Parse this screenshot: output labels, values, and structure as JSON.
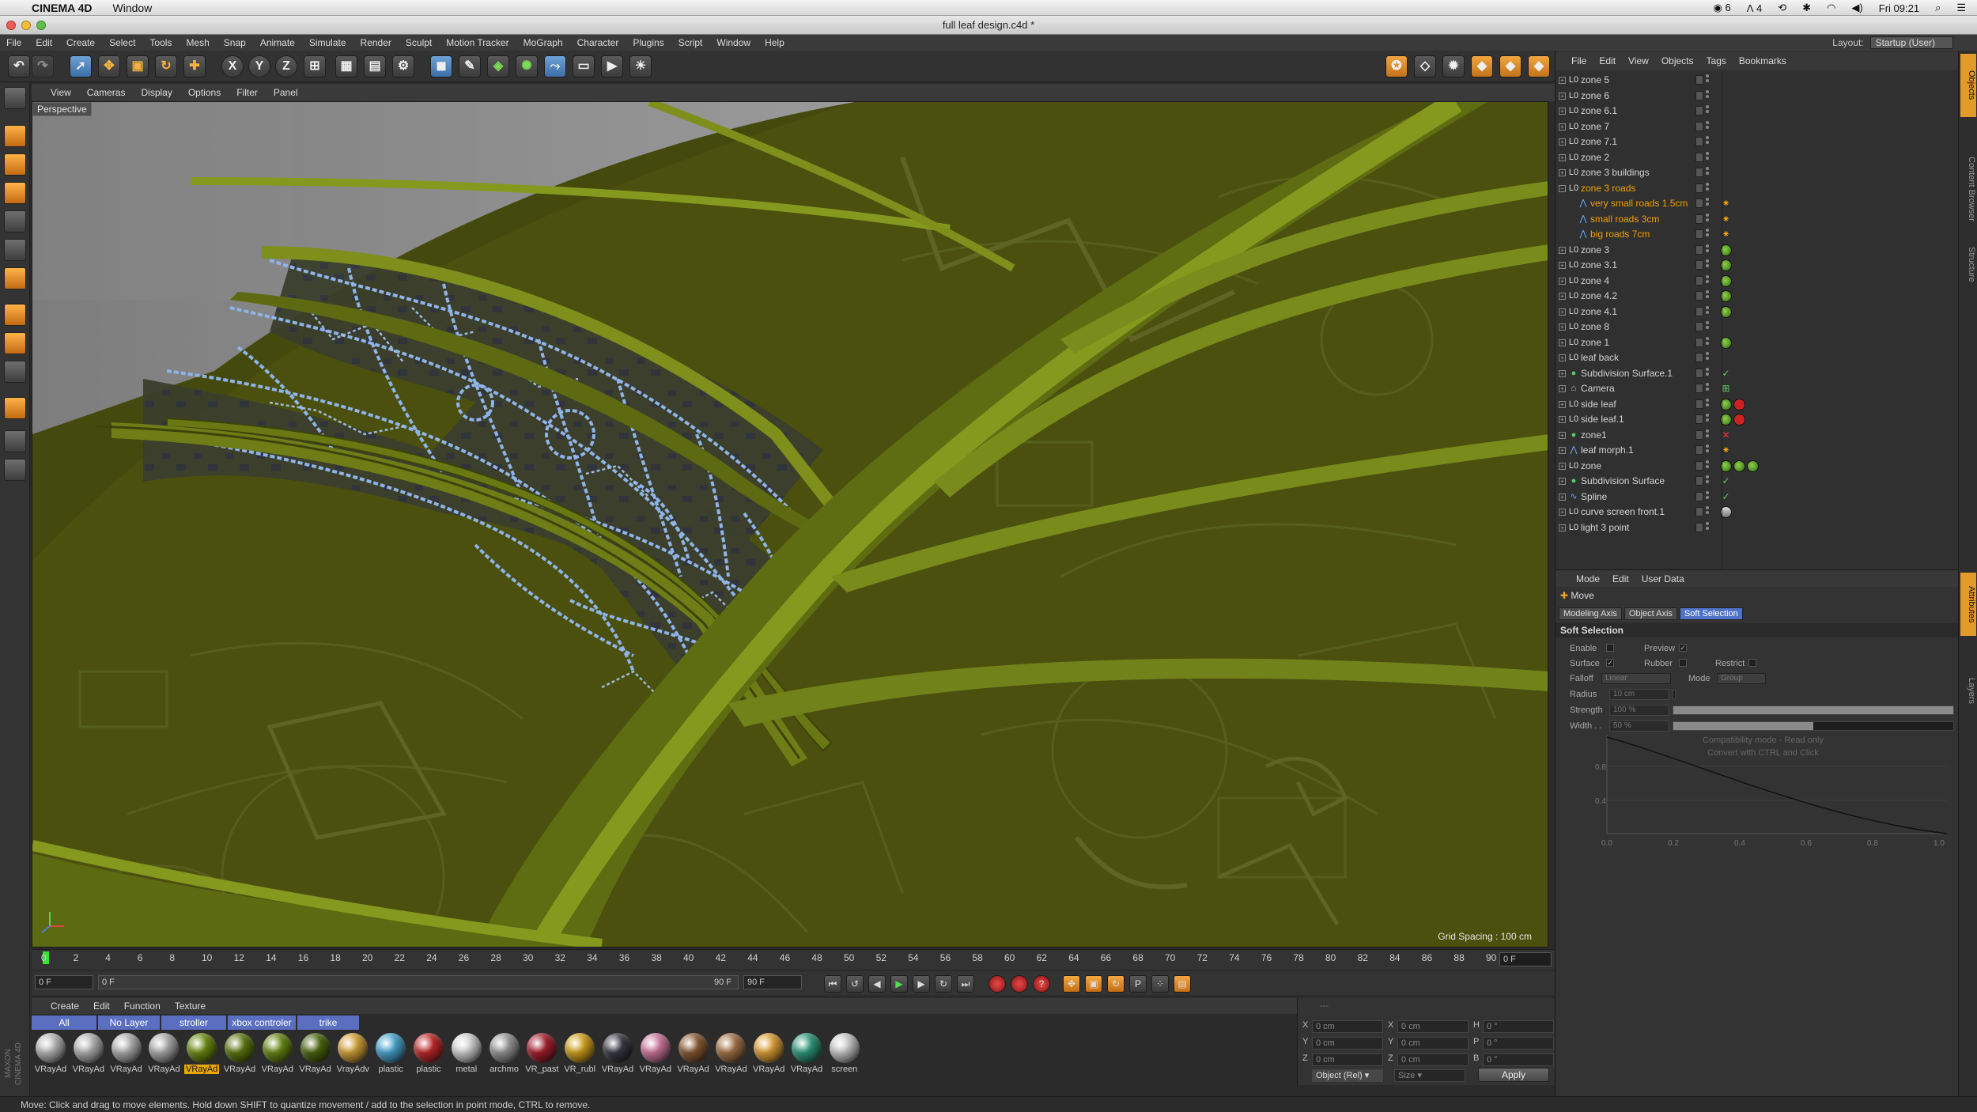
{
  "mac_menu": {
    "app_name": "CINEMA 4D",
    "items": [
      "Window"
    ],
    "status_right": {
      "badge1": "6",
      "badge2": "4",
      "clock": "Fri 09:21"
    }
  },
  "window": {
    "title": "full leaf design.c4d *"
  },
  "app_menu": [
    "File",
    "Edit",
    "Create",
    "Select",
    "Tools",
    "Mesh",
    "Snap",
    "Animate",
    "Simulate",
    "Render",
    "Sculpt",
    "Motion Tracker",
    "MoGraph",
    "Character",
    "Plugins",
    "Script",
    "Window",
    "Help"
  ],
  "layout": {
    "label": "Layout:",
    "value": "Startup (User)"
  },
  "viewport": {
    "menu": [
      "View",
      "Cameras",
      "Display",
      "Options",
      "Filter",
      "Panel"
    ],
    "label": "Perspective",
    "grid_spacing": "Grid Spacing : 100 cm",
    "colors": {
      "leaf": "#4a4f0e",
      "vein": "#5c6a12",
      "roads": "#7aa6e6",
      "map_lines": "#5d6422"
    }
  },
  "timeline": {
    "ticks": [
      "0",
      "2",
      "4",
      "6",
      "8",
      "10",
      "12",
      "14",
      "16",
      "18",
      "20",
      "22",
      "24",
      "26",
      "28",
      "30",
      "32",
      "34",
      "36",
      "38",
      "40",
      "42",
      "44",
      "46",
      "48",
      "50",
      "52",
      "54",
      "56",
      "58",
      "60",
      "62",
      "64",
      "66",
      "68",
      "70",
      "72",
      "74",
      "76",
      "78",
      "80",
      "82",
      "84",
      "86",
      "88",
      "90"
    ],
    "current_frame": "0 F",
    "start": "0 F",
    "range_start": "0 F",
    "range_end": "90 F",
    "end": "90 F"
  },
  "material_manager": {
    "menu": [
      "Create",
      "Edit",
      "Function",
      "Texture"
    ],
    "filters": [
      "All",
      "No Layer",
      "stroller",
      "xbox controler",
      "trike"
    ],
    "materials": [
      {
        "label": "VRayAd",
        "color": "#bdbdbd"
      },
      {
        "label": "VRayAd",
        "color": "#b8b8b8"
      },
      {
        "label": "VRayAd",
        "color": "#b5b5b5"
      },
      {
        "label": "VRayAd",
        "color": "#b0b0b0"
      },
      {
        "label": "VRayAd",
        "color": "#6f8e12",
        "active": true
      },
      {
        "label": "VRayAd",
        "color": "#5f7a10"
      },
      {
        "label": "VRayAd",
        "color": "#6a8a14"
      },
      {
        "label": "VRayAd",
        "color": "#4d6810"
      },
      {
        "label": "VrayAdv",
        "color": "#d7a53a"
      },
      {
        "label": "plastic",
        "color": "#4ba9d6"
      },
      {
        "label": "plastic",
        "color": "#c22a2a"
      },
      {
        "label": "metal",
        "color": "#d9d9d9"
      },
      {
        "label": "archmo",
        "color": "#9a9a9a"
      },
      {
        "label": "VR_past",
        "color": "#a61f2f"
      },
      {
        "label": "VR_rubl",
        "color": "#d5a51d"
      },
      {
        "label": "VRayAd",
        "color": "#3a3a44"
      },
      {
        "label": "VRayAd",
        "color": "#d27aa0"
      },
      {
        "label": "VRayAd",
        "color": "#8a5a33"
      },
      {
        "label": "VRayAd",
        "color": "#a77548"
      },
      {
        "label": "VRayAd",
        "color": "#e3a33a"
      },
      {
        "label": "VRayAd",
        "color": "#2e9b7d"
      },
      {
        "label": "screen",
        "color": "#cfcfcf"
      }
    ]
  },
  "coordinates": {
    "rows": [
      {
        "axis": "X",
        "pos": "0 cm",
        "size_axis": "X",
        "size": "0 cm",
        "rot_axis": "H",
        "rot": "0 °"
      },
      {
        "axis": "Y",
        "pos": "0 cm",
        "size_axis": "Y",
        "size": "0 cm",
        "rot_axis": "P",
        "rot": "0 °"
      },
      {
        "axis": "Z",
        "pos": "0 cm",
        "size_axis": "Z",
        "size": "0 cm",
        "rot_axis": "B",
        "rot": "0 °"
      }
    ],
    "mode": "Object (Rel)",
    "size_mode": "Size",
    "apply": "Apply"
  },
  "status_bar": "Move: Click and drag to move elements. Hold down SHIFT to quantize movement / add to the selection in point mode, CTRL to remove.",
  "object_manager": {
    "menu": [
      "File",
      "Edit",
      "View",
      "Objects",
      "Tags",
      "Bookmarks"
    ],
    "objects": [
      {
        "name": "zone 5",
        "icon": "L0",
        "indent": 0,
        "tags": []
      },
      {
        "name": "zone 6",
        "icon": "L0",
        "indent": 0,
        "tags": []
      },
      {
        "name": "zone 6.1",
        "icon": "L0",
        "indent": 0,
        "tags": []
      },
      {
        "name": "zone 7",
        "icon": "L0",
        "indent": 0,
        "tags": []
      },
      {
        "name": "zone 7.1",
        "icon": "L0",
        "indent": 0,
        "tags": []
      },
      {
        "name": "zone 2",
        "icon": "L0",
        "indent": 0,
        "tags": []
      },
      {
        "name": "zone 3 buildings",
        "icon": "L0",
        "indent": 0,
        "tags": []
      },
      {
        "name": "zone 3 roads",
        "icon": "L0",
        "indent": 0,
        "tags": [],
        "highlight": true,
        "expanded": true
      },
      {
        "name": "very small roads 1.5cm",
        "icon": "spline",
        "indent": 1,
        "tags": [
          "spot"
        ],
        "highlight": true
      },
      {
        "name": "small roads 3cm",
        "icon": "spline",
        "indent": 1,
        "tags": [
          "spot"
        ],
        "highlight": true
      },
      {
        "name": "big roads 7cm",
        "icon": "spline",
        "indent": 1,
        "tags": [
          "spot"
        ],
        "highlight": true
      },
      {
        "name": "zone 3",
        "icon": "L0",
        "indent": 0,
        "tags": [
          "green"
        ]
      },
      {
        "name": "zone 3.1",
        "icon": "L0",
        "indent": 0,
        "tags": [
          "green"
        ]
      },
      {
        "name": "zone 4",
        "icon": "L0",
        "indent": 0,
        "tags": [
          "green"
        ]
      },
      {
        "name": "zone 4.2",
        "icon": "L0",
        "indent": 0,
        "tags": [
          "green"
        ]
      },
      {
        "name": "zone 4.1",
        "icon": "L0",
        "indent": 0,
        "tags": [
          "green"
        ]
      },
      {
        "name": "zone 8",
        "icon": "L0",
        "indent": 0,
        "tags": []
      },
      {
        "name": "zone 1",
        "icon": "L0",
        "indent": 0,
        "tags": [
          "green"
        ]
      },
      {
        "name": "leaf back",
        "icon": "L0",
        "indent": 0,
        "tags": []
      },
      {
        "name": "Subdivision Surface.1",
        "icon": "subd",
        "indent": 0,
        "tags": [],
        "check": "tick"
      },
      {
        "name": "Camera",
        "icon": "camera",
        "indent": 0,
        "tags": [],
        "check": "grid"
      },
      {
        "name": "side leaf",
        "icon": "L0",
        "indent": 0,
        "tags": [
          "green",
          "red"
        ]
      },
      {
        "name": "side leaf.1",
        "icon": "L0",
        "indent": 0,
        "tags": [
          "green",
          "red"
        ]
      },
      {
        "name": "zone1",
        "icon": "subd",
        "indent": 0,
        "tags": [],
        "check": "cross"
      },
      {
        "name": "leaf morph.1",
        "icon": "spline",
        "indent": 0,
        "tags": [
          "spot"
        ]
      },
      {
        "name": "zone",
        "icon": "L0",
        "indent": 0,
        "tags": [
          "green",
          "green",
          "green"
        ]
      },
      {
        "name": "Subdivision Surface",
        "icon": "subd",
        "indent": 0,
        "tags": [],
        "check": "tick"
      },
      {
        "name": "Spline",
        "icon": "spline2",
        "indent": 0,
        "tags": [],
        "check": "tick"
      },
      {
        "name": "curve screen front.1",
        "icon": "L0",
        "indent": 0,
        "tags": [
          "white"
        ]
      },
      {
        "name": "light 3 point",
        "icon": "L0",
        "indent": 0,
        "tags": []
      }
    ]
  },
  "attributes": {
    "menu": [
      "Mode",
      "Edit",
      "User Data"
    ],
    "title": "Move",
    "tabs": [
      "Modeling Axis",
      "Object Axis",
      "Soft Selection"
    ],
    "active_tab": "Soft Selection",
    "section": "Soft Selection",
    "enable": "Enable",
    "preview": "Preview",
    "surface": "Surface",
    "rubber": "Rubber",
    "restrict": "Restrict",
    "falloff": "Falloff",
    "falloff_value": "Linear",
    "mode": "Mode",
    "mode_value": "Group",
    "radius": "Radius",
    "radius_value": "10 cm",
    "strength": "Strength",
    "strength_value": "100 %",
    "strength_level": 1.0,
    "width": "Width . .",
    "width_value": "50 %",
    "width_level": 0.5,
    "note1": "Compatibility mode - Read only",
    "note2": "Convert with CTRL and Click",
    "graph_y_ticks": [
      "0.8",
      "0.4"
    ],
    "graph_x_ticks": [
      "0.0",
      "0.2",
      "0.4",
      "0.6",
      "0.8",
      "1.0"
    ]
  },
  "side_tabs": [
    "Objects",
    "Content Browser",
    "Structure",
    "Attributes",
    "Layers"
  ]
}
